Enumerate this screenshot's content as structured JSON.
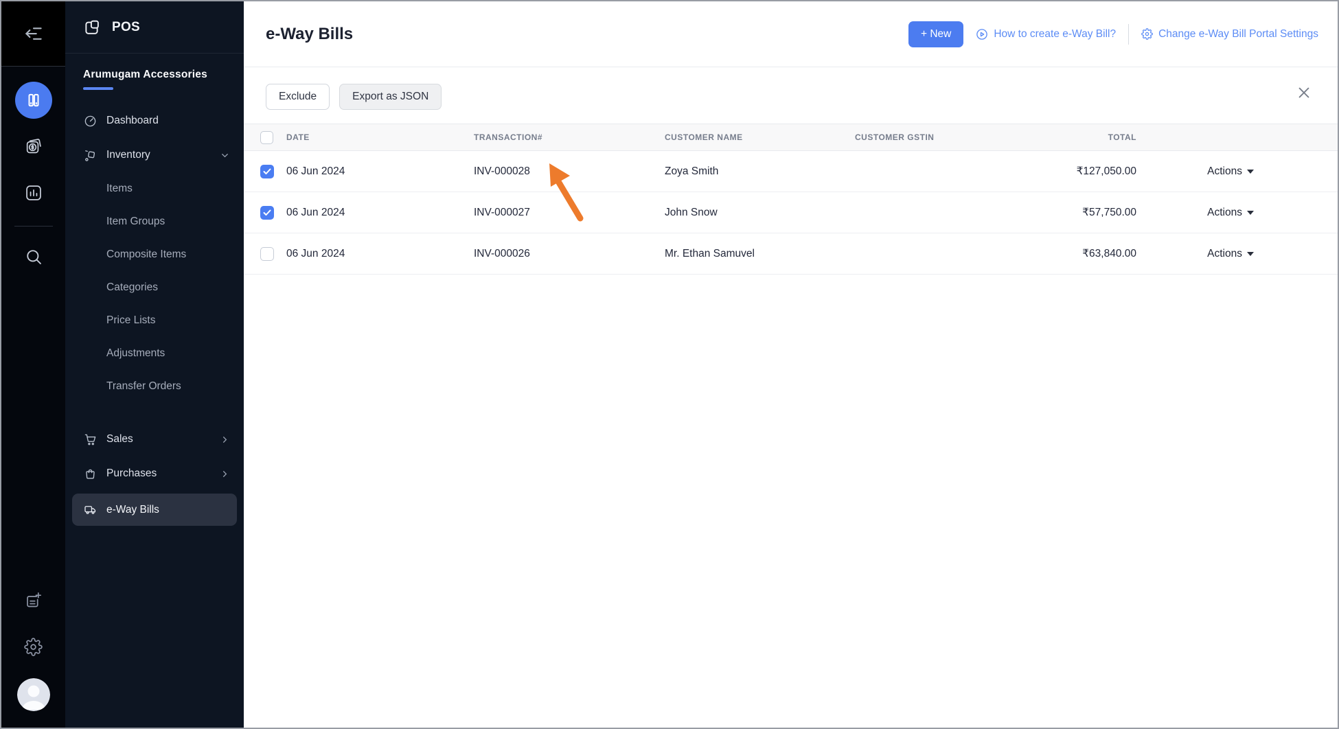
{
  "app": {
    "name": "POS",
    "company": "Arumugam Accessories"
  },
  "iconbar": {
    "icons": [
      "collapse-sidebar",
      "inventory-app",
      "billing-app",
      "reports-app",
      "search",
      "add-document",
      "settings",
      "user-avatar"
    ]
  },
  "sidebar": {
    "dashboard": "Dashboard",
    "inventory": "Inventory",
    "inventory_children": [
      "Items",
      "Item Groups",
      "Composite Items",
      "Categories",
      "Price Lists",
      "Adjustments",
      "Transfer Orders"
    ],
    "sales": "Sales",
    "purchases": "Purchases",
    "eway_bills": "e-Way Bills"
  },
  "header": {
    "title": "e-Way Bills",
    "new_button": "+ New",
    "help_link": "How to create e-Way Bill?",
    "settings_link": "Change e-Way Bill Portal Settings"
  },
  "toolbar": {
    "exclude_button": "Exclude",
    "export_button": "Export as JSON"
  },
  "table": {
    "columns": [
      "DATE",
      "TRANSACTION#",
      "CUSTOMER NAME",
      "CUSTOMER GSTIN",
      "TOTAL"
    ],
    "actions_label": "Actions",
    "rows": [
      {
        "checked": true,
        "date": "06 Jun 2024",
        "transaction": "INV-000028",
        "customer": "Zoya Smith",
        "gstin": "",
        "total": "₹127,050.00"
      },
      {
        "checked": true,
        "date": "06 Jun 2024",
        "transaction": "INV-000027",
        "customer": "John Snow",
        "gstin": "",
        "total": "₹57,750.00"
      },
      {
        "checked": false,
        "date": "06 Jun 2024",
        "transaction": "INV-000026",
        "customer": "Mr. Ethan Samuvel",
        "gstin": "",
        "total": "₹63,840.00"
      }
    ]
  },
  "colors": {
    "accent_blue": "#4c7cf0",
    "link_blue": "#5c8cf5",
    "checkbox_blue": "#4a7df2",
    "sidebar_bg": "#0d1522",
    "iconbar_bg": "#04070d",
    "active_item_bg": "#2b3241",
    "annotation_orange": "#ed7b2c"
  }
}
